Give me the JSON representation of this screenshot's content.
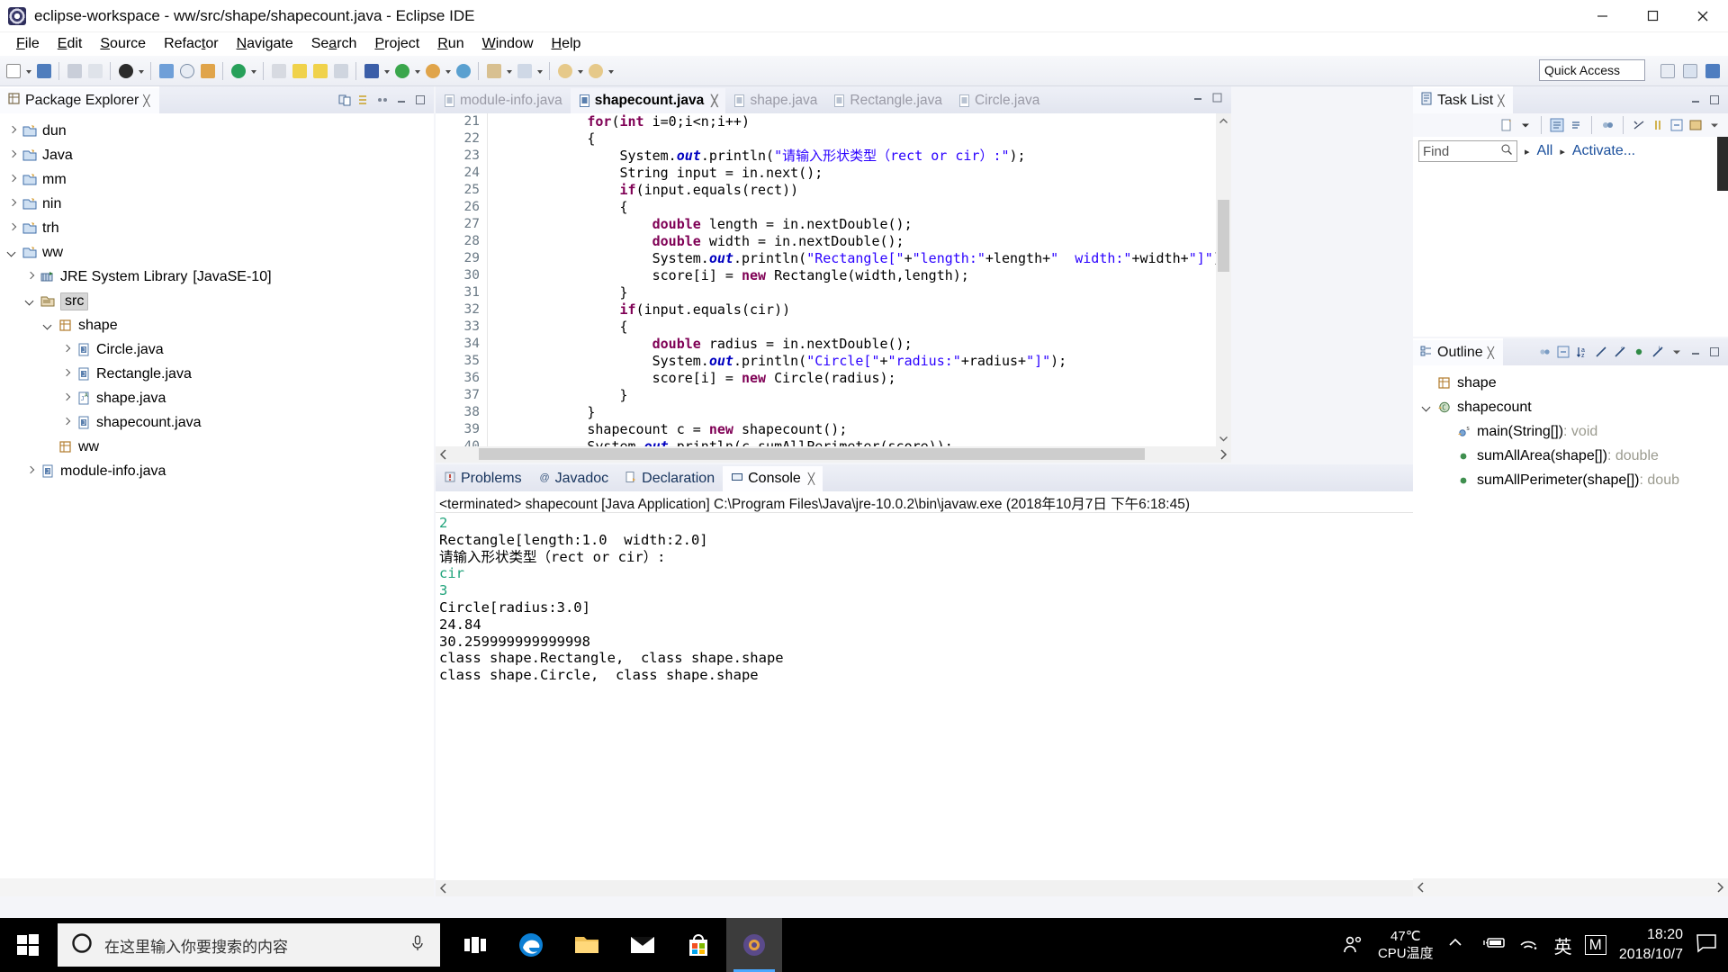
{
  "window": {
    "title": "eclipse-workspace - ww/src/shape/shapecount.java - Eclipse IDE",
    "minimize": "—",
    "maximize": "❐",
    "close": "✕"
  },
  "menubar": {
    "items": [
      {
        "label": "File",
        "mnemonic": "F"
      },
      {
        "label": "Edit",
        "mnemonic": "E"
      },
      {
        "label": "Source",
        "mnemonic": "S"
      },
      {
        "label": "Refactor",
        "mnemonic": "t"
      },
      {
        "label": "Navigate",
        "mnemonic": "N"
      },
      {
        "label": "Search",
        "mnemonic": "a"
      },
      {
        "label": "Project",
        "mnemonic": "P"
      },
      {
        "label": "Run",
        "mnemonic": "R"
      },
      {
        "label": "Window",
        "mnemonic": "W"
      },
      {
        "label": "Help",
        "mnemonic": "H"
      }
    ]
  },
  "toolbar": {
    "quick_access_placeholder": "Quick Access"
  },
  "package_explorer": {
    "title": "Package Explorer",
    "close_label": "╳",
    "tree": [
      {
        "label": "dun",
        "indent": 0,
        "twist": "closed",
        "icon": "project-icon"
      },
      {
        "label": "Java",
        "indent": 0,
        "twist": "closed",
        "icon": "project-icon"
      },
      {
        "label": "mm",
        "indent": 0,
        "twist": "closed",
        "icon": "project-icon"
      },
      {
        "label": "nin",
        "indent": 0,
        "twist": "closed",
        "icon": "project-icon"
      },
      {
        "label": "trh",
        "indent": 0,
        "twist": "closed",
        "icon": "project-icon"
      },
      {
        "label": "ww",
        "indent": 0,
        "twist": "open",
        "icon": "project-icon"
      },
      {
        "label": "JRE System Library",
        "suffix": "[JavaSE-10]",
        "indent": 1,
        "twist": "closed",
        "icon": "library-icon"
      },
      {
        "label": "src",
        "indent": 1,
        "twist": "open",
        "icon": "source-folder-icon",
        "selected": true
      },
      {
        "label": "shape",
        "indent": 2,
        "twist": "open",
        "icon": "package-icon"
      },
      {
        "label": "Circle.java",
        "indent": 3,
        "twist": "closed",
        "icon": "java-class-icon"
      },
      {
        "label": "Rectangle.java",
        "indent": 3,
        "twist": "closed",
        "icon": "java-class-icon"
      },
      {
        "label": "shape.java",
        "indent": 3,
        "twist": "closed",
        "icon": "java-abstract-icon"
      },
      {
        "label": "shapecount.java",
        "indent": 3,
        "twist": "closed",
        "icon": "java-class-icon"
      },
      {
        "label": "ww",
        "indent": 2,
        "twist": "none",
        "icon": "package-icon"
      },
      {
        "label": "module-info.java",
        "indent": 1,
        "twist": "closed",
        "icon": "java-class-icon"
      }
    ]
  },
  "editor": {
    "tabs": [
      {
        "label": "module-info.java",
        "active": false,
        "closable": false
      },
      {
        "label": "shapecount.java",
        "active": true,
        "closable": true
      },
      {
        "label": "shape.java",
        "active": false,
        "closable": false
      },
      {
        "label": "Rectangle.java",
        "active": false,
        "closable": false
      },
      {
        "label": "Circle.java",
        "active": false,
        "closable": false
      }
    ],
    "first_line_number": 21,
    "lines": [
      {
        "n": 21,
        "tokens": [
          {
            "t": "            ",
            "c": ""
          },
          {
            "t": "for",
            "c": "kw"
          },
          {
            "t": "(",
            "c": ""
          },
          {
            "t": "int",
            "c": "kw"
          },
          {
            "t": " i=0;i<n;i++)",
            "c": ""
          }
        ]
      },
      {
        "n": 22,
        "tokens": [
          {
            "t": "            {",
            "c": ""
          }
        ]
      },
      {
        "n": 23,
        "tokens": [
          {
            "t": "                System.",
            "c": ""
          },
          {
            "t": "out",
            "c": "fld"
          },
          {
            "t": ".println(",
            "c": ""
          },
          {
            "t": "\"请输入形状类型（rect or cir）:\"",
            "c": "str"
          },
          {
            "t": ");",
            "c": ""
          }
        ]
      },
      {
        "n": 24,
        "tokens": [
          {
            "t": "                ",
            "c": ""
          },
          {
            "t": "String",
            "c": ""
          },
          {
            "t": " input = in.next();",
            "c": ""
          }
        ]
      },
      {
        "n": 25,
        "tokens": [
          {
            "t": "                ",
            "c": ""
          },
          {
            "t": "if",
            "c": "kw"
          },
          {
            "t": "(input.equals(rect))",
            "c": ""
          }
        ]
      },
      {
        "n": 26,
        "tokens": [
          {
            "t": "                {",
            "c": ""
          }
        ]
      },
      {
        "n": 27,
        "tokens": [
          {
            "t": "                    ",
            "c": ""
          },
          {
            "t": "double",
            "c": "kw"
          },
          {
            "t": " length = in.nextDouble();",
            "c": ""
          }
        ]
      },
      {
        "n": 28,
        "tokens": [
          {
            "t": "                    ",
            "c": ""
          },
          {
            "t": "double",
            "c": "kw"
          },
          {
            "t": " width = in.nextDouble();",
            "c": ""
          }
        ]
      },
      {
        "n": 29,
        "tokens": [
          {
            "t": "                    System.",
            "c": ""
          },
          {
            "t": "out",
            "c": "fld"
          },
          {
            "t": ".println(",
            "c": ""
          },
          {
            "t": "\"Rectangle[\"",
            "c": "str"
          },
          {
            "t": "+",
            "c": ""
          },
          {
            "t": "\"length:\"",
            "c": "str"
          },
          {
            "t": "+length+",
            "c": ""
          },
          {
            "t": "\"  width:\"",
            "c": "str"
          },
          {
            "t": "+width+",
            "c": ""
          },
          {
            "t": "\"]\"",
            "c": "str"
          },
          {
            "t": ");",
            "c": ""
          }
        ]
      },
      {
        "n": 30,
        "tokens": [
          {
            "t": "                    score[i] = ",
            "c": ""
          },
          {
            "t": "new",
            "c": "kw"
          },
          {
            "t": " Rectangle(width,length);",
            "c": ""
          }
        ]
      },
      {
        "n": 31,
        "tokens": [
          {
            "t": "                }",
            "c": ""
          }
        ]
      },
      {
        "n": 32,
        "tokens": [
          {
            "t": "                ",
            "c": ""
          },
          {
            "t": "if",
            "c": "kw"
          },
          {
            "t": "(input.equals(cir))",
            "c": ""
          }
        ]
      },
      {
        "n": 33,
        "tokens": [
          {
            "t": "                {",
            "c": ""
          }
        ]
      },
      {
        "n": 34,
        "tokens": [
          {
            "t": "                    ",
            "c": ""
          },
          {
            "t": "double",
            "c": "kw"
          },
          {
            "t": " radius = in.nextDouble();",
            "c": ""
          }
        ]
      },
      {
        "n": 35,
        "tokens": [
          {
            "t": "                    System.",
            "c": ""
          },
          {
            "t": "out",
            "c": "fld"
          },
          {
            "t": ".println(",
            "c": ""
          },
          {
            "t": "\"Circle[\"",
            "c": "str"
          },
          {
            "t": "+",
            "c": ""
          },
          {
            "t": "\"radius:\"",
            "c": "str"
          },
          {
            "t": "+radius+",
            "c": ""
          },
          {
            "t": "\"]\"",
            "c": "str"
          },
          {
            "t": ");",
            "c": ""
          }
        ]
      },
      {
        "n": 36,
        "tokens": [
          {
            "t": "                    score[i] = ",
            "c": ""
          },
          {
            "t": "new",
            "c": "kw"
          },
          {
            "t": " Circle(radius);",
            "c": ""
          }
        ]
      },
      {
        "n": 37,
        "tokens": [
          {
            "t": "                }",
            "c": ""
          }
        ]
      },
      {
        "n": 38,
        "tokens": [
          {
            "t": "            }",
            "c": ""
          }
        ]
      },
      {
        "n": 39,
        "tokens": [
          {
            "t": "            shapecount c = ",
            "c": ""
          },
          {
            "t": "new",
            "c": "kw"
          },
          {
            "t": " shapecount();",
            "c": ""
          }
        ]
      },
      {
        "n": 40,
        "tokens": [
          {
            "t": "            System.",
            "c": ""
          },
          {
            "t": "out",
            "c": "fld"
          },
          {
            "t": ".println(c.sumAllPerimeter(score));",
            "c": ""
          }
        ]
      }
    ]
  },
  "console": {
    "tabs": [
      {
        "label": "Problems",
        "active": false,
        "icon": "problems-icon"
      },
      {
        "label": "Javadoc",
        "active": false,
        "icon": "javadoc-icon"
      },
      {
        "label": "Declaration",
        "active": false,
        "icon": "declaration-icon"
      },
      {
        "label": "Console",
        "active": true,
        "icon": "console-icon"
      }
    ],
    "header": "<terminated> shapecount [Java Application] C:\\Program Files\\Java\\jre-10.0.2\\bin\\javaw.exe (2018年10月7日 下午6:18:45)",
    "output": [
      {
        "text": "2",
        "kind": "input"
      },
      {
        "text": "Rectangle[length:1.0  width:2.0]",
        "kind": "output"
      },
      {
        "text": "请输入形状类型（rect or cir）:",
        "kind": "output"
      },
      {
        "text": "cir",
        "kind": "input"
      },
      {
        "text": "3",
        "kind": "input"
      },
      {
        "text": "Circle[radius:3.0]",
        "kind": "output"
      },
      {
        "text": "24.84",
        "kind": "output"
      },
      {
        "text": "30.259999999999998",
        "kind": "output"
      },
      {
        "text": "class shape.Rectangle,  class shape.shape",
        "kind": "output"
      },
      {
        "text": "class shape.Circle,  class shape.shape",
        "kind": "output"
      }
    ]
  },
  "task_list": {
    "title": "Task List",
    "close_label": "╳",
    "find_placeholder": "Find",
    "breadcrumbs": [
      "All",
      "Activate..."
    ]
  },
  "outline": {
    "title": "Outline",
    "close_label": "╳",
    "items": [
      {
        "label": "shape",
        "indent": 0,
        "twist": "none",
        "icon": "package-icon",
        "return_type": ""
      },
      {
        "label": "shapecount",
        "indent": 0,
        "twist": "open",
        "icon": "class-icon",
        "return_type": ""
      },
      {
        "label": "main(String[])",
        "indent": 1,
        "twist": "none",
        "icon": "method-static-icon",
        "return_type": " : void"
      },
      {
        "label": "sumAllArea(shape[])",
        "indent": 1,
        "twist": "none",
        "icon": "method-public-icon",
        "return_type": " : double"
      },
      {
        "label": "sumAllPerimeter(shape[])",
        "indent": 1,
        "twist": "none",
        "icon": "method-public-icon",
        "return_type": " : doub"
      }
    ]
  },
  "taskbar": {
    "search_placeholder": "在这里输入你要搜索的内容",
    "cpu_temp_value": "47℃",
    "cpu_temp_label": "CPU温度",
    "ime_label": "英",
    "ime_mode": "M",
    "time": "18:20",
    "date": "2018/10/7"
  },
  "colors": {
    "accent_blue": "#0a5fc2",
    "keyword_purple": "#7f0055",
    "string_blue": "#2a00ff",
    "field_blue": "#0000c0",
    "console_input_green": "#1fa37a",
    "taskbar_black": "#000000"
  }
}
